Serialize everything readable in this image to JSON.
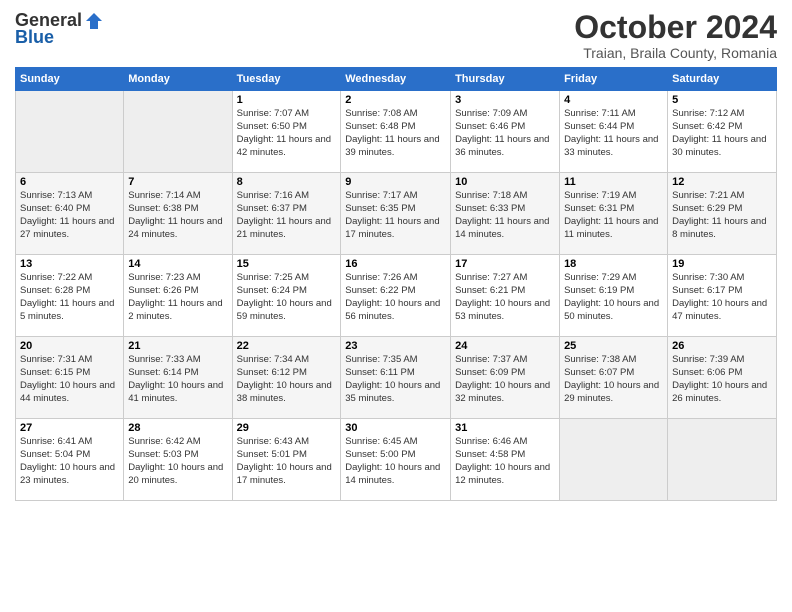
{
  "header": {
    "logo_general": "General",
    "logo_blue": "Blue",
    "month": "October 2024",
    "location": "Traian, Braila County, Romania"
  },
  "weekdays": [
    "Sunday",
    "Monday",
    "Tuesday",
    "Wednesday",
    "Thursday",
    "Friday",
    "Saturday"
  ],
  "weeks": [
    [
      {
        "day": "",
        "info": ""
      },
      {
        "day": "",
        "info": ""
      },
      {
        "day": "1",
        "info": "Sunrise: 7:07 AM\nSunset: 6:50 PM\nDaylight: 11 hours and 42 minutes."
      },
      {
        "day": "2",
        "info": "Sunrise: 7:08 AM\nSunset: 6:48 PM\nDaylight: 11 hours and 39 minutes."
      },
      {
        "day": "3",
        "info": "Sunrise: 7:09 AM\nSunset: 6:46 PM\nDaylight: 11 hours and 36 minutes."
      },
      {
        "day": "4",
        "info": "Sunrise: 7:11 AM\nSunset: 6:44 PM\nDaylight: 11 hours and 33 minutes."
      },
      {
        "day": "5",
        "info": "Sunrise: 7:12 AM\nSunset: 6:42 PM\nDaylight: 11 hours and 30 minutes."
      }
    ],
    [
      {
        "day": "6",
        "info": "Sunrise: 7:13 AM\nSunset: 6:40 PM\nDaylight: 11 hours and 27 minutes."
      },
      {
        "day": "7",
        "info": "Sunrise: 7:14 AM\nSunset: 6:38 PM\nDaylight: 11 hours and 24 minutes."
      },
      {
        "day": "8",
        "info": "Sunrise: 7:16 AM\nSunset: 6:37 PM\nDaylight: 11 hours and 21 minutes."
      },
      {
        "day": "9",
        "info": "Sunrise: 7:17 AM\nSunset: 6:35 PM\nDaylight: 11 hours and 17 minutes."
      },
      {
        "day": "10",
        "info": "Sunrise: 7:18 AM\nSunset: 6:33 PM\nDaylight: 11 hours and 14 minutes."
      },
      {
        "day": "11",
        "info": "Sunrise: 7:19 AM\nSunset: 6:31 PM\nDaylight: 11 hours and 11 minutes."
      },
      {
        "day": "12",
        "info": "Sunrise: 7:21 AM\nSunset: 6:29 PM\nDaylight: 11 hours and 8 minutes."
      }
    ],
    [
      {
        "day": "13",
        "info": "Sunrise: 7:22 AM\nSunset: 6:28 PM\nDaylight: 11 hours and 5 minutes."
      },
      {
        "day": "14",
        "info": "Sunrise: 7:23 AM\nSunset: 6:26 PM\nDaylight: 11 hours and 2 minutes."
      },
      {
        "day": "15",
        "info": "Sunrise: 7:25 AM\nSunset: 6:24 PM\nDaylight: 10 hours and 59 minutes."
      },
      {
        "day": "16",
        "info": "Sunrise: 7:26 AM\nSunset: 6:22 PM\nDaylight: 10 hours and 56 minutes."
      },
      {
        "day": "17",
        "info": "Sunrise: 7:27 AM\nSunset: 6:21 PM\nDaylight: 10 hours and 53 minutes."
      },
      {
        "day": "18",
        "info": "Sunrise: 7:29 AM\nSunset: 6:19 PM\nDaylight: 10 hours and 50 minutes."
      },
      {
        "day": "19",
        "info": "Sunrise: 7:30 AM\nSunset: 6:17 PM\nDaylight: 10 hours and 47 minutes."
      }
    ],
    [
      {
        "day": "20",
        "info": "Sunrise: 7:31 AM\nSunset: 6:15 PM\nDaylight: 10 hours and 44 minutes."
      },
      {
        "day": "21",
        "info": "Sunrise: 7:33 AM\nSunset: 6:14 PM\nDaylight: 10 hours and 41 minutes."
      },
      {
        "day": "22",
        "info": "Sunrise: 7:34 AM\nSunset: 6:12 PM\nDaylight: 10 hours and 38 minutes."
      },
      {
        "day": "23",
        "info": "Sunrise: 7:35 AM\nSunset: 6:11 PM\nDaylight: 10 hours and 35 minutes."
      },
      {
        "day": "24",
        "info": "Sunrise: 7:37 AM\nSunset: 6:09 PM\nDaylight: 10 hours and 32 minutes."
      },
      {
        "day": "25",
        "info": "Sunrise: 7:38 AM\nSunset: 6:07 PM\nDaylight: 10 hours and 29 minutes."
      },
      {
        "day": "26",
        "info": "Sunrise: 7:39 AM\nSunset: 6:06 PM\nDaylight: 10 hours and 26 minutes."
      }
    ],
    [
      {
        "day": "27",
        "info": "Sunrise: 6:41 AM\nSunset: 5:04 PM\nDaylight: 10 hours and 23 minutes."
      },
      {
        "day": "28",
        "info": "Sunrise: 6:42 AM\nSunset: 5:03 PM\nDaylight: 10 hours and 20 minutes."
      },
      {
        "day": "29",
        "info": "Sunrise: 6:43 AM\nSunset: 5:01 PM\nDaylight: 10 hours and 17 minutes."
      },
      {
        "day": "30",
        "info": "Sunrise: 6:45 AM\nSunset: 5:00 PM\nDaylight: 10 hours and 14 minutes."
      },
      {
        "day": "31",
        "info": "Sunrise: 6:46 AM\nSunset: 4:58 PM\nDaylight: 10 hours and 12 minutes."
      },
      {
        "day": "",
        "info": ""
      },
      {
        "day": "",
        "info": ""
      }
    ]
  ]
}
